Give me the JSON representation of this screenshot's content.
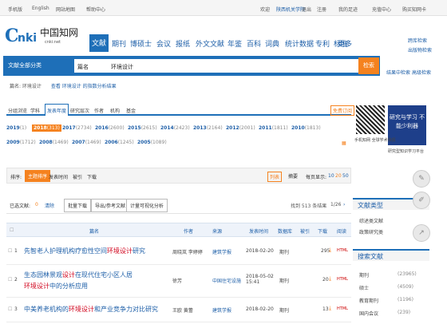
{
  "topbar": {
    "items": [
      "手机版",
      "English",
      "网站地图",
      "帮助中心"
    ],
    "right": [
      "欢迎",
      "陕西机关学院",
      "退出",
      "注册",
      "我的足迹",
      "充值中心",
      "购买知网卡"
    ],
    "institution": "陕西机关学院"
  },
  "logo": {
    "brand": "中国知网",
    "url": "cnki.net"
  },
  "nav": {
    "active": "文献",
    "tabs": [
      "期刊",
      "博硕士",
      "会议",
      "报纸",
      "外文文献",
      "年鉴",
      "百科",
      "词典",
      "统计数据",
      "专利",
      "标准",
      "更多"
    ]
  },
  "search": {
    "category": "文献全部分类",
    "field": "篇名",
    "value": "环境设计",
    "button": "检索",
    "right_links": [
      "跨库检索",
      "出版物检索",
      "结果中检索",
      "高级检索"
    ]
  },
  "breadcrumb": {
    "text": "篇名: 环境设计",
    "suggest": "查看 环境设计 的指数分析结果"
  },
  "filters": {
    "tabs": [
      "分组浏览",
      "学科",
      "发表年度",
      "研究层次",
      "作者",
      "机构",
      "基金"
    ],
    "active": "发表年度",
    "free_label": "免费订阅",
    "years": [
      {
        "y": "2019",
        "n": "(1)"
      },
      {
        "y": "2018",
        "n": "(313)"
      },
      {
        "y": "2017",
        "n": "(2734)"
      },
      {
        "y": "2016",
        "n": "(2600)"
      },
      {
        "y": "2015",
        "n": "(2615)"
      },
      {
        "y": "2014",
        "n": "(2423)"
      },
      {
        "y": "2013",
        "n": "(2164)"
      },
      {
        "y": "2012",
        "n": "(2001)"
      },
      {
        "y": "2011",
        "n": "(1811)"
      },
      {
        "y": "2010",
        "n": "(1813)"
      },
      {
        "y": "2009",
        "n": "(1712)"
      },
      {
        "y": "2008",
        "n": "(1469)"
      },
      {
        "y": "2007",
        "n": "(1469)"
      },
      {
        "y": "2006",
        "n": "(1245)"
      },
      {
        "y": "2005",
        "n": "(1089)"
      }
    ]
  },
  "sort": {
    "label": "排序:",
    "options": [
      "主题排序",
      "发表时间",
      "被引",
      "下载"
    ],
    "active": "主题排序",
    "view_list": "列表",
    "view_abstract": "摘要",
    "per_page_label": "每页显示:",
    "per_page": [
      "10",
      "20",
      "50"
    ]
  },
  "batch": {
    "selected_label": "已选文献:",
    "selected_count": "0",
    "clear": "清除",
    "download": "批量下载",
    "export": "导出/参考文献",
    "visual": "计量可视化分析",
    "result_count": "找到 513 条结果",
    "page": "1/26"
  },
  "table": {
    "headers": [
      "篇名",
      "作者",
      "来源",
      "发表时间",
      "数据库",
      "被引",
      "下载",
      "阅读"
    ],
    "rows": [
      {
        "num": "1",
        "pre": "先智老人护理机构疗愈性空间",
        "hl": "环境设计",
        "post": "研究",
        "author": "周晓岚 李婷婷",
        "source": "建筑学报",
        "date": "2018-02-20",
        "db": "期刊",
        "cited": "",
        "dl": "295"
      },
      {
        "num": "2",
        "pre": "生态园林景观",
        "hl": "设计",
        "post": "在现代住宅小区人居",
        "hl2": "环境设计",
        "post2": "中的分析应用",
        "author": "徐芳",
        "source": "中国住宅设施",
        "date": "2018-05-02 15:41",
        "db": "期刊",
        "cited": "",
        "dl": "20"
      },
      {
        "num": "3",
        "pre": "中美养老机构的",
        "hl": "环境设计",
        "post": "和产业竞争力对比研究",
        "author": "王欧 黄蕾",
        "source": "建筑学报",
        "date": "2018-02-20",
        "db": "期刊",
        "cited": "",
        "dl": "13"
      }
    ]
  },
  "sidebar": {
    "ad_text": "研究与学习 不能少利器",
    "qr_caption": "手机知网 全球学术快报",
    "ad_caption": "研究型知识学习平台",
    "section1": "文献类型",
    "types": [
      "综述类文献",
      "政策研究类"
    ],
    "section2": "搜索文献",
    "levels": [
      {
        "name": "期刊",
        "n": "(23965)"
      },
      {
        "name": "硕士",
        "n": "(4509)"
      },
      {
        "name": "教育期刊",
        "n": "(1196)"
      },
      {
        "name": "国内会议",
        "n": "(239)"
      }
    ]
  },
  "colors": {
    "brand": "#1e6fb8",
    "accent": "#f5821f",
    "highlight": "#d0021b"
  }
}
